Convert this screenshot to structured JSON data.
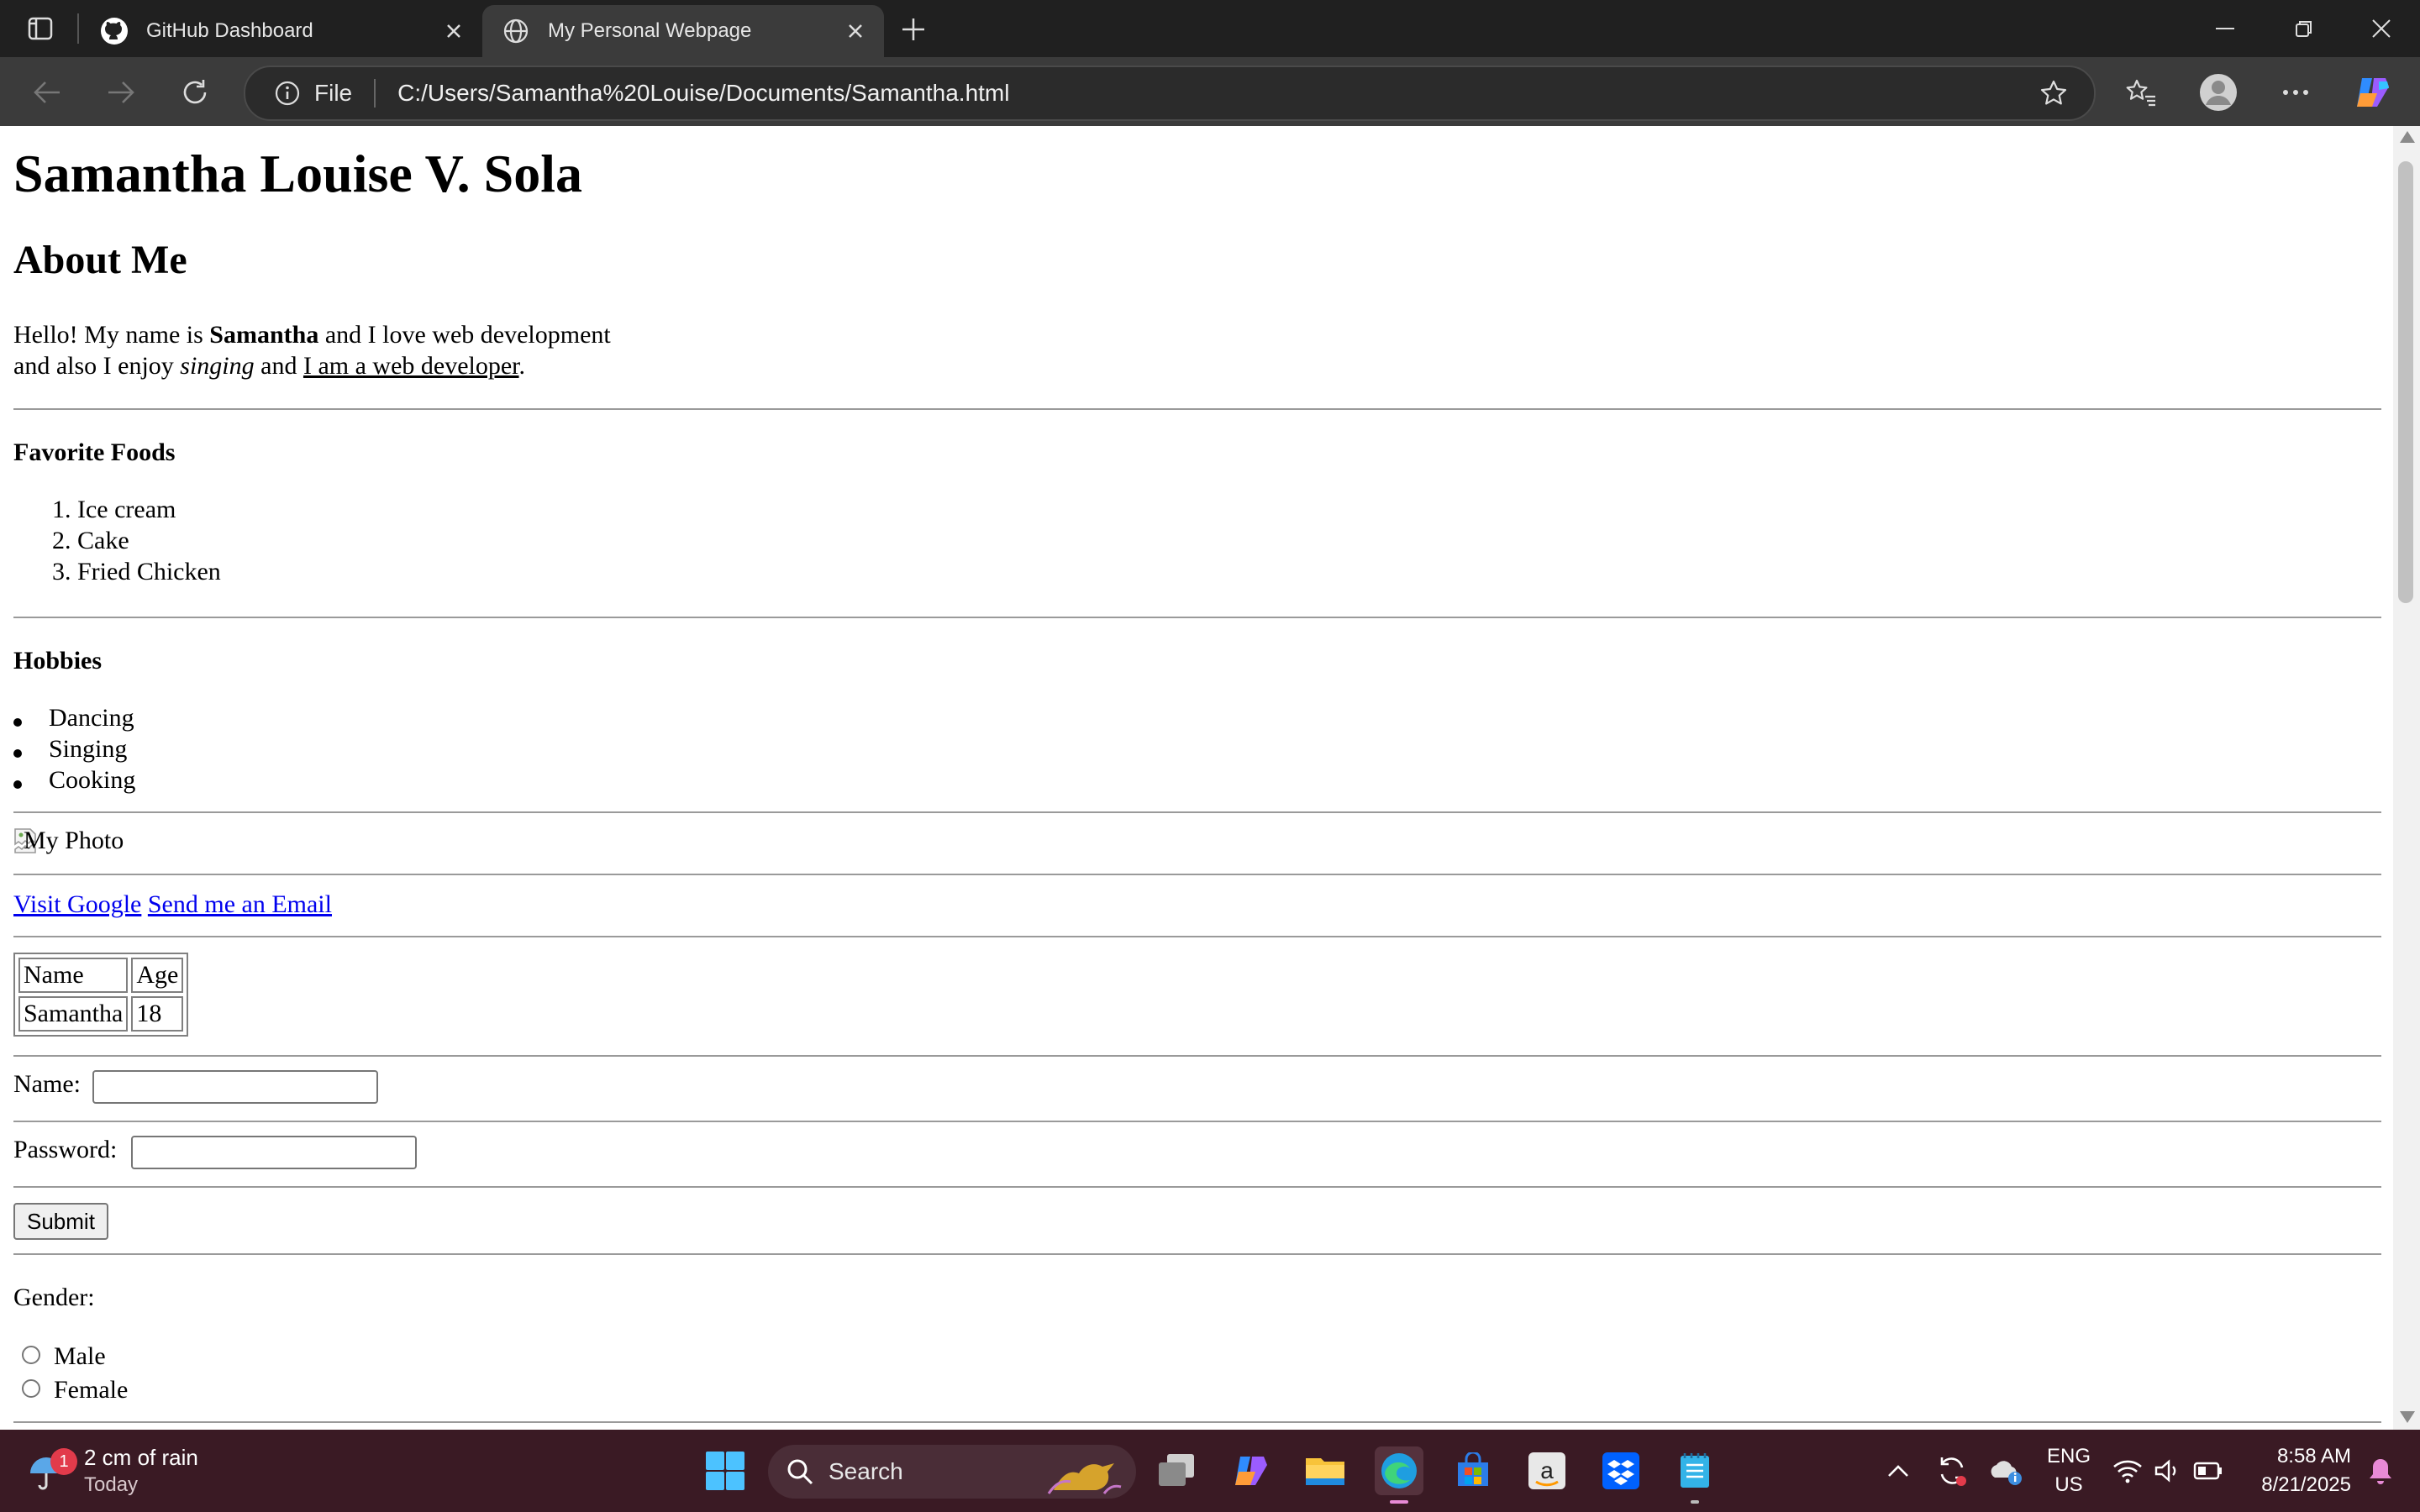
{
  "browser": {
    "tabs": [
      {
        "title": "GitHub Dashboard",
        "icon": "github-icon"
      },
      {
        "title": "My Personal Webpage",
        "icon": "globe-icon",
        "active": true
      }
    ],
    "address": {
      "scheme_label": "File",
      "url": "C:/Users/Samantha%20Louise/Documents/Samantha.html"
    }
  },
  "page": {
    "name_heading": "Samantha Louise V. Sola",
    "about_heading": "About Me",
    "about": {
      "line1_pre": "Hello! My name is ",
      "line1_bold": "Samantha",
      "line1_post": " and I love web development",
      "line2_pre": "and also I enjoy ",
      "line2_italic": "singing",
      "line2_mid": " and ",
      "line2_underline": "I am a web developer",
      "line2_post": "."
    },
    "foods_heading": "Favorite Foods",
    "foods": [
      "Ice cream",
      "Cake",
      "Fried Chicken"
    ],
    "hobbies_heading": "Hobbies",
    "hobbies": [
      "Dancing",
      "Singing",
      "Cooking"
    ],
    "photo_alt": "My Photo",
    "links": {
      "google": "Visit Google",
      "email": "Send me an Email"
    },
    "table": {
      "headers": [
        "Name",
        "Age"
      ],
      "rows": [
        [
          "Samantha",
          "18"
        ]
      ]
    },
    "form": {
      "name_label": "Name:",
      "name_value": "",
      "password_label": "Password:",
      "password_value": "",
      "submit_label": "Submit",
      "gender_label": "Gender:",
      "gender_options": [
        "Male",
        "Female"
      ]
    }
  },
  "taskbar": {
    "weather": {
      "badge": "1",
      "text": "2 cm of rain",
      "sub": "Today"
    },
    "search_label": "Search",
    "lang": {
      "line1": "ENG",
      "line2": "US"
    },
    "clock": {
      "time": "8:58 AM",
      "date": "8/21/2025"
    }
  }
}
